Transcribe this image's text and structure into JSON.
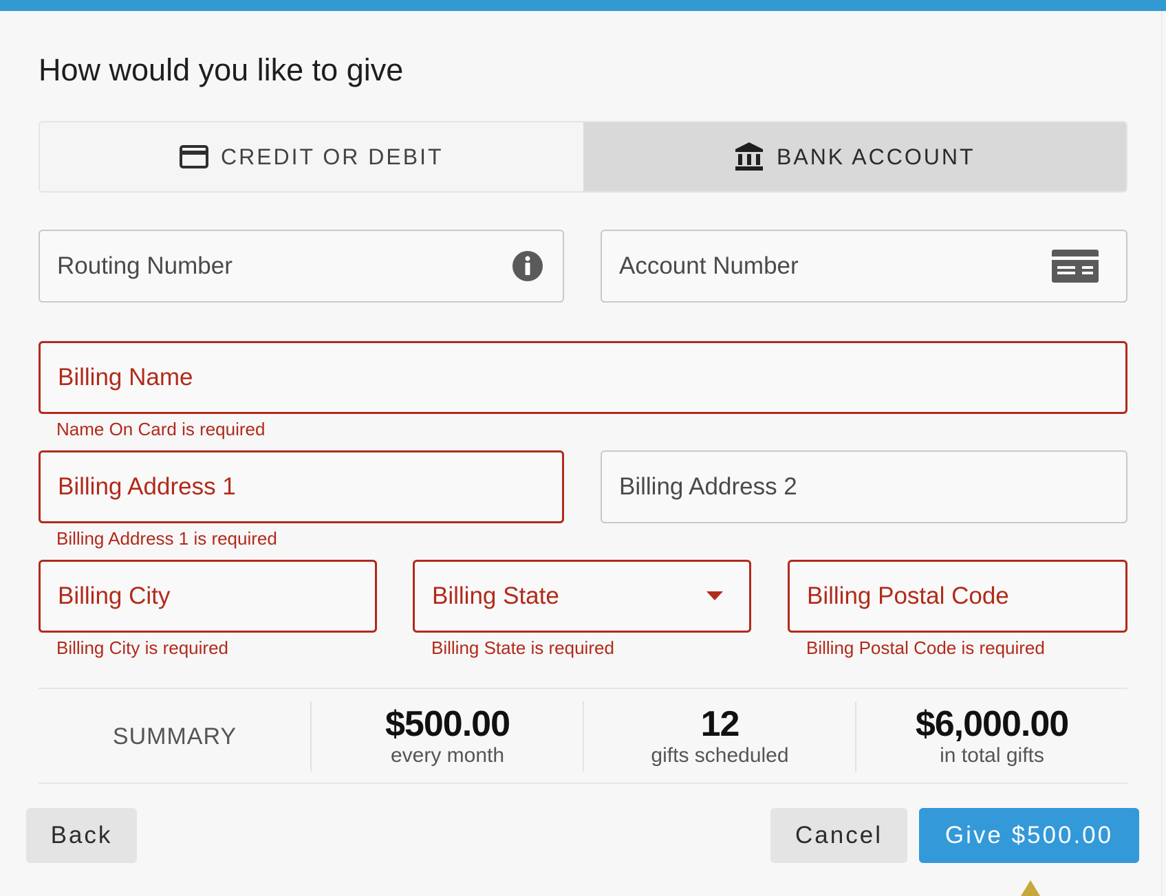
{
  "heading": "How would you like to give",
  "tabs": [
    {
      "label": "CREDIT OR DEBIT",
      "icon": "credit-card-icon",
      "selected": false
    },
    {
      "label": "BANK ACCOUNT",
      "icon": "bank-icon",
      "selected": true
    }
  ],
  "fields": {
    "routing": {
      "placeholder": "Routing Number",
      "icon": "info-icon"
    },
    "account": {
      "placeholder": "Account Number",
      "icon": "check-icon"
    },
    "billing_name": {
      "placeholder": "Billing Name",
      "error": "Name On Card is required"
    },
    "address1": {
      "placeholder": "Billing Address 1",
      "error": "Billing Address 1 is required"
    },
    "address2": {
      "placeholder": "Billing Address 2"
    },
    "city": {
      "placeholder": "Billing City",
      "error": "Billing City is required"
    },
    "state": {
      "placeholder": "Billing State",
      "error": "Billing State is required",
      "icon": "dropdown-arrow-icon"
    },
    "postal": {
      "placeholder": "Billing Postal Code",
      "error": "Billing Postal Code is required"
    }
  },
  "summary": {
    "label": "SUMMARY",
    "amount": {
      "value": "$500.00",
      "sub": "every month"
    },
    "count": {
      "value": "12",
      "sub": "gifts scheduled"
    },
    "total": {
      "value": "$6,000.00",
      "sub": "in total gifts"
    }
  },
  "buttons": {
    "back": "Back",
    "cancel": "Cancel",
    "give": "Give $500.00"
  },
  "colors": {
    "accent": "#3399d9",
    "error": "#b22a1a",
    "tab_selected_bg": "#d9d9d9"
  }
}
